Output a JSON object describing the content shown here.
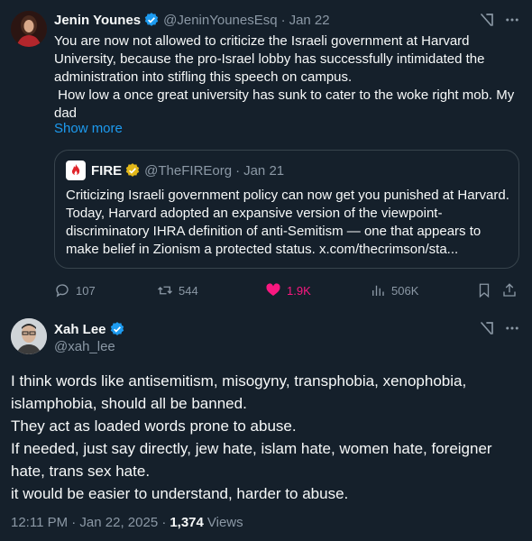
{
  "tweet1": {
    "name": "Jenin Younes",
    "handle": "@JeninYounesEsq",
    "sep": "·",
    "date": "Jan 22",
    "text": "You are now not allowed to criticize the Israeli government at Harvard University, because the pro-Israel lobby has successfully intimidated the administration into stifling this speech on campus.\n How low a once great university has sunk to cater to the woke right mob. My dad",
    "show_more": "Show more",
    "quote": {
      "name": "FIRE",
      "handle": "@TheFIREorg",
      "sep": "·",
      "date": "Jan 21",
      "text": "Criticizing Israeli government policy can now get you punished at Harvard. Today, Harvard adopted an expansive version of the viewpoint-discriminatory IHRA definition of anti-Semitism — one that appears to make belief in Zionism a protected status. x.com/thecrimson/sta..."
    },
    "actions": {
      "replies": "107",
      "reposts": "544",
      "likes": "1.9K",
      "views": "506K"
    }
  },
  "tweet2": {
    "name": "Xah Lee",
    "handle": "@xah_lee",
    "text": "I think words like antisemitism, misogyny, transphobia, xenophobia, islamphobia, should all be banned.\nThey act as loaded words prone to abuse.\nIf needed, just say directly, jew hate, islam hate, women hate, foreigner hate, trans sex hate.\nit would be easier to understand, harder to abuse.",
    "time": "12:11 PM · Jan 22, 2025 ·",
    "views_count": "1,374",
    "views_label": "Views"
  },
  "colors": {
    "background": "#15202b",
    "text": "#f7f9f9",
    "muted": "#8b98a5",
    "link": "#1d9bf0",
    "like": "#f91880",
    "verified": "#1d9bf0",
    "org_verified": "#e2b719"
  },
  "icons": [
    "grok-icon",
    "more-icon",
    "reply-icon",
    "repost-icon",
    "like-icon",
    "views-icon",
    "bookmark-icon",
    "share-icon",
    "verified-badge-icon",
    "fire-logo"
  ]
}
